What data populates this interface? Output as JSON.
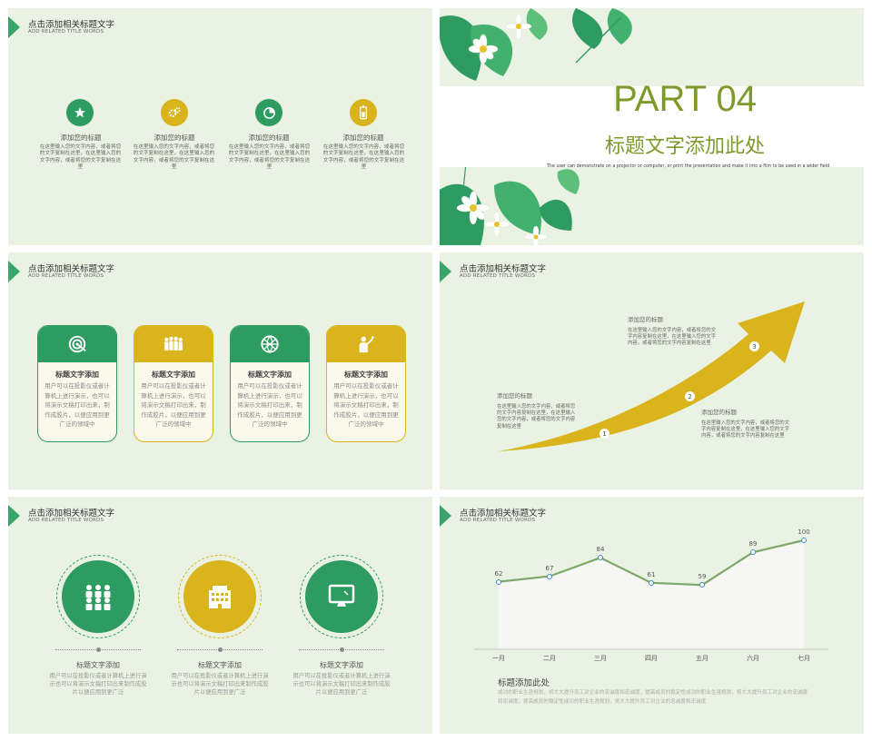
{
  "header": {
    "title": "点击添加相关标题文字",
    "subtitle": "ADD RELATED TITLE WORDS"
  },
  "slide1": {
    "items": [
      {
        "title": "添加您的标题",
        "text": "在这里输入您的文字内容，或者将您的文字复制在这里，在这里输入您的文字内容，或者将您的文字复制在这里",
        "icon": "star-icon",
        "color": "green"
      },
      {
        "title": "添加您的标题",
        "text": "在这里输入您的文字内容，或者将您的文字复制在这里，在这里输入您的文字内容，或者将您的文字复制在这里",
        "icon": "gears-icon",
        "color": "yellow"
      },
      {
        "title": "添加您的标题",
        "text": "在这里输入您的文字内容，或者将您的文字复制在这里，在这里输入您的文字内容，或者将您的文字复制在这里",
        "icon": "pie-chart-icon",
        "color": "green"
      },
      {
        "title": "添加您的标题",
        "text": "在这里输入您的文字内容，或者将您的文字复制在这里，在这里输入您的文字内容，或者将您的文字复制在这里",
        "icon": "battery-icon",
        "color": "yellow"
      }
    ]
  },
  "slide2": {
    "part": "PART 04",
    "title": "标题文字添加此处",
    "desc": "The user can demonstrate on a projector or computer, or print the presentation and make it into a film to be used in a wider field"
  },
  "slide3": {
    "cards": [
      {
        "title": "标题文字添加",
        "text": "用户可以在投影仪或者计算机上进行演示，也可以将演示文稿打印出来，制作成胶片，以便应用到更广泛的领域中",
        "icon": "target-icon",
        "color": "green"
      },
      {
        "title": "标题文字添加",
        "text": "用户可以在投影仪或者计算机上进行演示，也可以将演示文稿打印出来，制作成胶片，以便应用到更广泛的领域中",
        "icon": "team-icon",
        "color": "yellow"
      },
      {
        "title": "标题文字添加",
        "text": "用户可以在投影仪或者计算机上进行演示，也可以将演示文稿打印出来，制作成胶片，以便应用到更广泛的领域中",
        "icon": "globe-icon",
        "color": "green"
      },
      {
        "title": "标题文字添加",
        "text": "用户可以在投影仪或者计算机上进行演示，也可以将演示文稿打印出来，制作成胶片，以便应用到更广泛的领域中",
        "icon": "presenter-icon",
        "color": "yellow"
      }
    ]
  },
  "slide4": {
    "steps": [
      {
        "num": "1",
        "title": "添加您的标题",
        "text": "在这里输入您的文字内容，或者将您的文字内容复制在这里，在这里输入您的文字内容，或者将您的文字内容复制在这里"
      },
      {
        "num": "2",
        "title": "添加您的标题",
        "text": "在这里输入您的文字内容，或者将您的文字内容复制在这里，在这里输入您的文字内容，或者将您的文字内容复制在这里"
      },
      {
        "num": "3",
        "title": "添加您的标题",
        "text": "在这里输入您的文字内容，或者将您的文字内容复制在这里，在这里输入您的文字内容，或者将您的文字内容复制在这里"
      }
    ]
  },
  "slide5": {
    "items": [
      {
        "title": "标题文字添加",
        "text": "用户可以在投影仪或者计算机上进行演示也可以将演示文稿打印出来制作成胶片以便应用到更广泛",
        "icon": "people-icon",
        "color": "green"
      },
      {
        "title": "标题文字添加",
        "text": "用户可以在投影仪或者计算机上进行演示也可以将演示文稿打印出来制作成胶片以便应用到更广泛",
        "icon": "building-icon",
        "color": "yellow"
      },
      {
        "title": "标题文字添加",
        "text": "用户可以在投影仪或者计算机上进行演示也可以将演示文稿打印出来制作成胶片以便应用到更广泛",
        "icon": "monitor-icon",
        "color": "green"
      }
    ]
  },
  "slide6": {
    "title": "标题添加此处",
    "text": "成功的职业生涯规划，将大大提升员工对企业的忠诚度和忠诚度，提高成员的稳定性成功的职业生涯规划，将大大提升员工对企业的忠诚度和忠诚度，提高成员的稳定性成功的职业生涯规划，将大大提升员工对企业的忠诚度和忠诚度"
  },
  "chart_data": {
    "type": "area",
    "categories": [
      "一月",
      "二月",
      "三月",
      "四月",
      "五月",
      "六月",
      "七月"
    ],
    "values": [
      62,
      67,
      84,
      61,
      59,
      89,
      100
    ],
    "ylim": [
      0,
      110
    ],
    "grid": false,
    "line_color": "#7ea86a",
    "fill_color": "#f6f7f5",
    "point_color": "#3b8ed0"
  },
  "colors": {
    "green": "#2e9b61",
    "yellow": "#d9b41c",
    "background": "#eaf3e3",
    "accent_text": "#7e9a2a"
  }
}
